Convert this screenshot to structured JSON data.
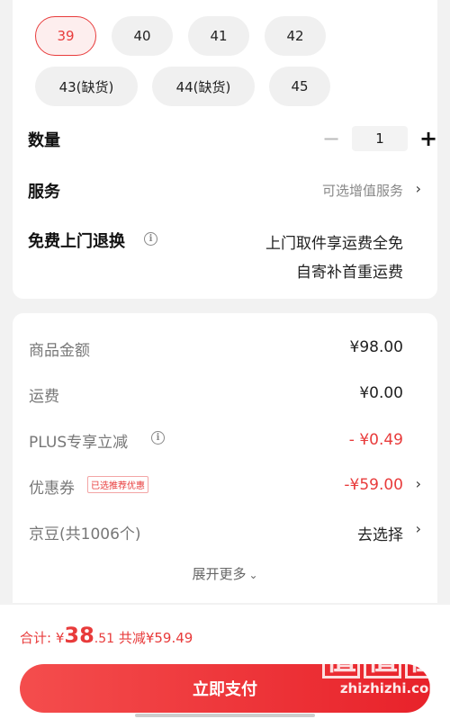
{
  "sizes": {
    "selected": "39",
    "options": [
      "39",
      "40",
      "41",
      "42",
      "43(缺货)",
      "44(缺货)",
      "45"
    ]
  },
  "quantity": {
    "label": "数量",
    "value": "1",
    "minus": "−",
    "plus": "+"
  },
  "service": {
    "label": "服务",
    "value": "可选增值服务"
  },
  "return_service": {
    "label": "免费上门退换",
    "line1": "上门取件享运费全免",
    "line2": "自寄补首重运费"
  },
  "price": {
    "goods_label": "商品金额",
    "goods_value": "¥98.00",
    "shipping_label": "运费",
    "shipping_value": "¥0.00",
    "plus_label": "PLUS专享立减",
    "plus_value": "- ¥0.49",
    "coupon_label": "优惠券",
    "coupon_badge": "已选推荐优惠",
    "coupon_value": "-¥59.00",
    "beans_label": "京豆(共1006个)",
    "beans_value": "去选择",
    "expand_label": "展开更多"
  },
  "total": {
    "label": "合计: ¥",
    "big": "38",
    "small": ".51",
    "discount": " 共减¥59.49"
  },
  "pay_button": "立即支付",
  "watermark": {
    "glyphs": [
      "值",
      "值",
      "值"
    ],
    "text": "zhizhizhi.com"
  },
  "colors": {
    "accent": "#e83b3b",
    "background": "#f2f2f2"
  }
}
